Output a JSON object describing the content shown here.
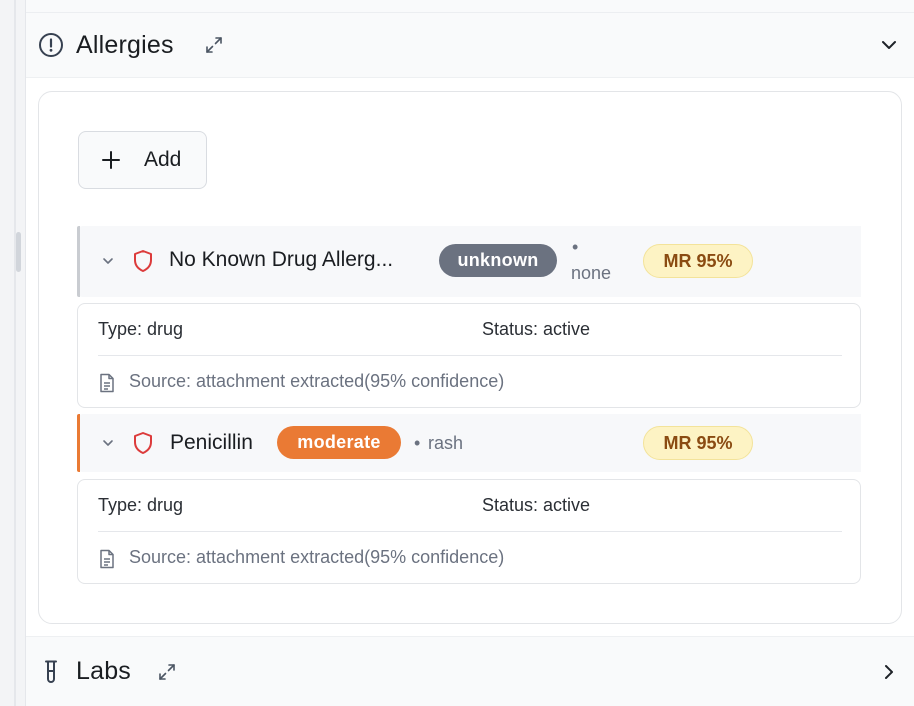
{
  "colors": {
    "unknown_badge": "#6b7280",
    "moderate_badge": "#ea7a34",
    "mr_badge_bg": "#fdf3c4",
    "mr_badge_text": "#8a4b12",
    "shield_icon": "#dc3b3b",
    "accent_unknown": "#c9ccd1",
    "accent_moderate": "#ea7a34"
  },
  "allergies_section": {
    "title": "Allergies",
    "icon": "alert-circle-icon",
    "add_label": "Add",
    "items": [
      {
        "name": "No Known Drug Allerg...",
        "severity": "unknown",
        "reaction_bullet": "•",
        "reaction": "none",
        "mr": "MR 95%",
        "type": "Type: drug",
        "status": "Status: active",
        "source": "Source: attachment extracted(95% confidence)"
      },
      {
        "name": "Penicillin",
        "severity": "moderate",
        "reaction_bullet": "•",
        "reaction": "rash",
        "mr": "MR 95%",
        "type": "Type: drug",
        "status": "Status: active",
        "source": "Source: attachment extracted(95% confidence)"
      }
    ]
  },
  "labs_section": {
    "title": "Labs",
    "icon": "test-tube-icon"
  }
}
